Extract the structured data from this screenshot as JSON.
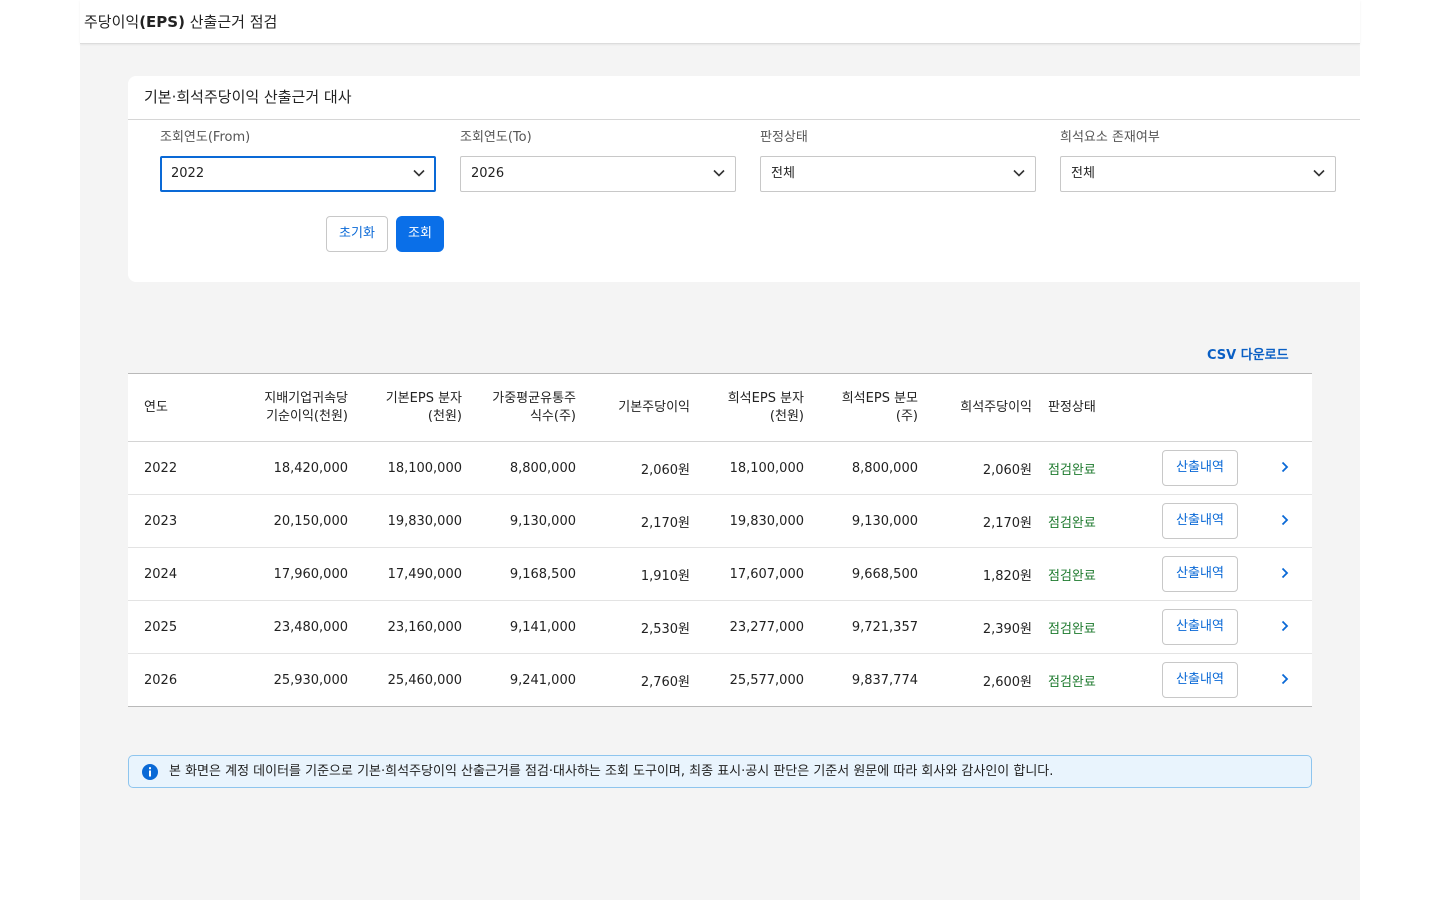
{
  "page": {
    "title_prefix": "주당이익",
    "title_bold": "(EPS)",
    "title_suffix": " 산출근거 점검"
  },
  "filter": {
    "header": "기본·희석주당이익 산출근거 대사",
    "fields": [
      {
        "label": "조회연도(From)",
        "value": "2022"
      },
      {
        "label": "조회연도(To)",
        "value": "2026"
      },
      {
        "label": "판정상태",
        "value": "전체"
      },
      {
        "label": "희석요소 존재여부",
        "value": "전체"
      }
    ],
    "reset_label": "초기화",
    "search_label": "조회"
  },
  "csv_label": "CSV 다운로드",
  "table": {
    "columns": [
      [
        "연도"
      ],
      [
        "지배기업귀속당",
        "기순이익(천원)"
      ],
      [
        "기본EPS 분자",
        "(천원)"
      ],
      [
        "가중평균유통주",
        "식수(주)"
      ],
      [
        "기본주당이익"
      ],
      [
        "희석EPS 분자",
        "(천원)"
      ],
      [
        "희석EPS 분모",
        "(주)"
      ],
      [
        "희석주당이익"
      ],
      [
        "판정상태"
      ]
    ],
    "detail_label": "산출내역",
    "rows": [
      {
        "year": "2022",
        "net_income": "18,420,000",
        "basic_num": "18,100,000",
        "wavg_shares": "8,800,000",
        "basic_eps": "2,060원",
        "diluted_num": "18,100,000",
        "diluted_den": "8,800,000",
        "diluted_eps": "2,060원",
        "status": "점검완료"
      },
      {
        "year": "2023",
        "net_income": "20,150,000",
        "basic_num": "19,830,000",
        "wavg_shares": "9,130,000",
        "basic_eps": "2,170원",
        "diluted_num": "19,830,000",
        "diluted_den": "9,130,000",
        "diluted_eps": "2,170원",
        "status": "점검완료"
      },
      {
        "year": "2024",
        "net_income": "17,960,000",
        "basic_num": "17,490,000",
        "wavg_shares": "9,168,500",
        "basic_eps": "1,910원",
        "diluted_num": "17,607,000",
        "diluted_den": "9,668,500",
        "diluted_eps": "1,820원",
        "status": "점검완료"
      },
      {
        "year": "2025",
        "net_income": "23,480,000",
        "basic_num": "23,160,000",
        "wavg_shares": "9,141,000",
        "basic_eps": "2,530원",
        "diluted_num": "23,277,000",
        "diluted_den": "9,721,357",
        "diluted_eps": "2,390원",
        "status": "점검완료"
      },
      {
        "year": "2026",
        "net_income": "25,930,000",
        "basic_num": "25,460,000",
        "wavg_shares": "9,241,000",
        "basic_eps": "2,760원",
        "diluted_num": "25,577,000",
        "diluted_den": "9,837,774",
        "diluted_eps": "2,600원",
        "status": "점검완료"
      }
    ]
  },
  "notice": {
    "icon": "info-icon",
    "text": "본 화면은 계정 데이터를 기준으로 기본·희석주당이익 산출근거를 점검·대사하는 조회 도구이며, 최종 표시·공시 판단은 기준서 원문에 따라 회사와 감사인이 합니다."
  },
  "colors": {
    "accent": "#0a6fe8",
    "status_ok": "#1e7a2e",
    "notice_bg": "#e9f4fd",
    "notice_border": "#8ec5ee"
  }
}
